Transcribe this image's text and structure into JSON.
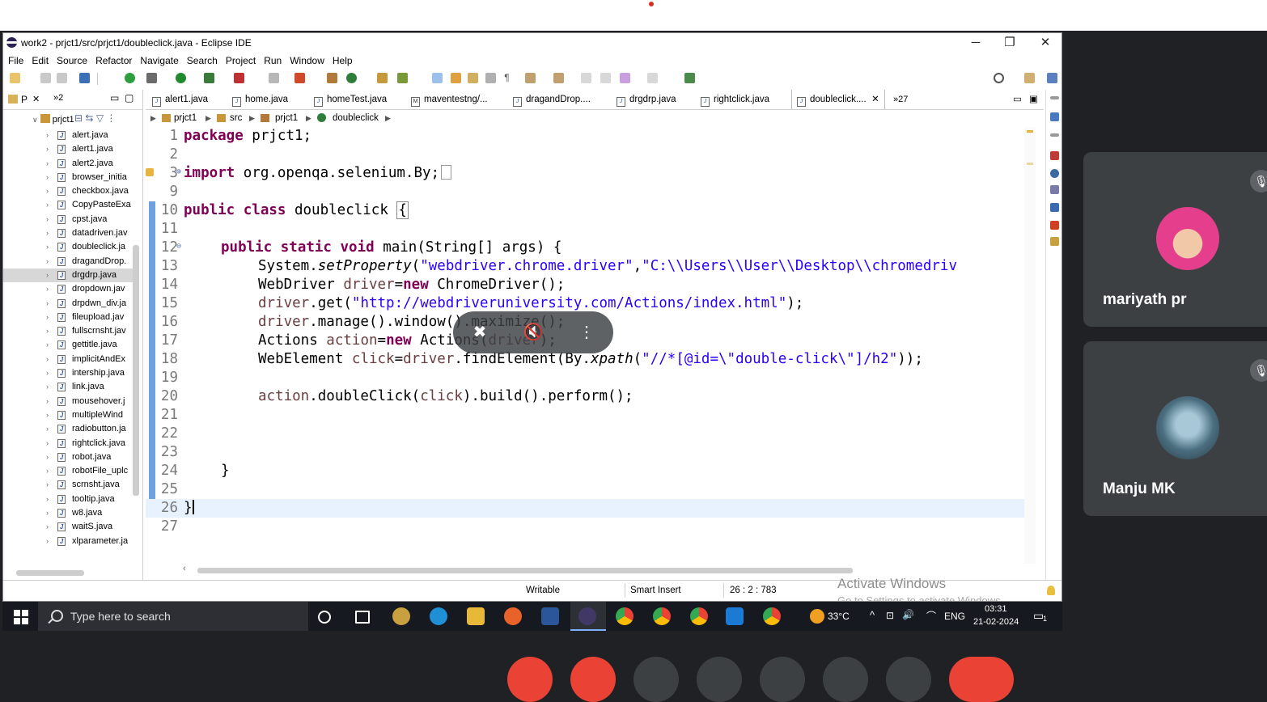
{
  "window": {
    "title": "work2 - prjct1/src/prjct1/doubleclick.java - Eclipse IDE",
    "minimize": "─",
    "restore": "❐",
    "close": "✕"
  },
  "menu": [
    "File",
    "Edit",
    "Source",
    "Refactor",
    "Navigate",
    "Search",
    "Project",
    "Run",
    "Window",
    "Help"
  ],
  "explorer": {
    "tab_label": "P",
    "tab_close": "✕",
    "overflow": "»2",
    "project": "prjct1",
    "files": [
      "alert.java",
      "alert1.java",
      "alert2.java",
      "browser_initia",
      "checkbox.java",
      "CopyPasteExa",
      "cpst.java",
      "datadriven.jav",
      "doubleclick.ja",
      "dragandDrop.",
      "drgdrp.java",
      "dropdown.jav",
      "drpdwn_div.ja",
      "fileupload.jav",
      "fullscrnsht.jav",
      "gettitle.java",
      "implicitAndEx",
      "intership.java",
      "link.java",
      "mousehover.j",
      "multipleWind",
      "radiobutton.ja",
      "rightclick.java",
      "robot.java",
      "robotFile_uplc",
      "scrnsht.java",
      "tooltip.java",
      "w8.java",
      "waitS.java",
      "xlparameter.ja"
    ],
    "selected_index": 10
  },
  "editor_tabs": {
    "items": [
      "alert1.java",
      "home.java",
      "homeTest.java",
      "maventestng/...",
      "dragandDrop....",
      "drgdrp.java",
      "rightclick.java",
      "doubleclick...."
    ],
    "active_close": "✕",
    "overflow": "»27"
  },
  "breadcrumb": [
    "prjct1",
    "src",
    "prjct1",
    "doubleclick"
  ],
  "code": {
    "line_numbers": [
      "1",
      "2",
      "3",
      "9",
      "10",
      "11",
      "12",
      "13",
      "14",
      "15",
      "16",
      "17",
      "18",
      "19",
      "20",
      "21",
      "22",
      "23",
      "24",
      "25",
      "26",
      "27"
    ],
    "fold_marks": {
      "3": "⊕",
      "12": "⊖"
    },
    "line1": {
      "kw": "package",
      "rest": " prjct1;"
    },
    "line3": {
      "kw": "import",
      "rest": " org.openqa.selenium.By;"
    },
    "line10": {
      "kw1": "public",
      "kw2": "class",
      "rest": " doubleclick ",
      "brace": "{"
    },
    "line12": {
      "kw": "public static void",
      "rest": " main(String[] args) {"
    },
    "line13": {
      "a": "System.",
      "m": "setProperty",
      "b": "(",
      "s1": "\"webdriver.chrome.driver\"",
      "c": ",",
      "s2": "\"C:\\\\Users\\\\User\\\\Desktop\\\\chromedriv"
    },
    "line14": {
      "a": "WebDriver ",
      "v": "driver",
      "b": "=",
      "kw": "new",
      "c": " ChromeDriver();"
    },
    "line15": {
      "v": "driver",
      "a": ".get(",
      "s": "\"http://webdriveruniversity.com/Actions/index.html\"",
      "b": ");"
    },
    "line16": {
      "v": "driver",
      "a": ".manage().window().maximize();"
    },
    "line17": {
      "a": "Actions ",
      "v": "action",
      "b": "=",
      "kw": "new",
      "c": " Actions(",
      "v2": "driver",
      "d": ");"
    },
    "line18": {
      "a": "WebElement ",
      "v": "click",
      "b": "=",
      "v2": "driver",
      "c": ".findElement(By.",
      "m": "xpath",
      "d": "(",
      "s": "\"//*[@id=\\\"double-click\\\"]/h2\"",
      "e": "));"
    },
    "line20": {
      "v": "action",
      "a": ".doubleClick(",
      "v2": "click",
      "b": ").build().perform();"
    },
    "line24": "}",
    "line26": "}"
  },
  "status": {
    "writable": "Writable",
    "insert": "Smart Insert",
    "position": "26 : 2 : 783"
  },
  "watermark": {
    "title": "Activate Windows",
    "subtitle": "Go to Settings to activate Windows."
  },
  "taskbar": {
    "search_placeholder": "Type here to search",
    "weather": "33°C",
    "lang": "ENG",
    "time": "03:31",
    "date": "21-02-2024",
    "notif_count": "1"
  },
  "participants": [
    {
      "name": "mariyath pr"
    },
    {
      "name": "Manju MK"
    }
  ],
  "colors": {
    "keyword": "#7f0055",
    "string": "#2a00ff",
    "variable": "#6a3e3e",
    "meet_bg": "#202124",
    "tile_bg": "#3c4043",
    "end_call": "#ea4335"
  }
}
